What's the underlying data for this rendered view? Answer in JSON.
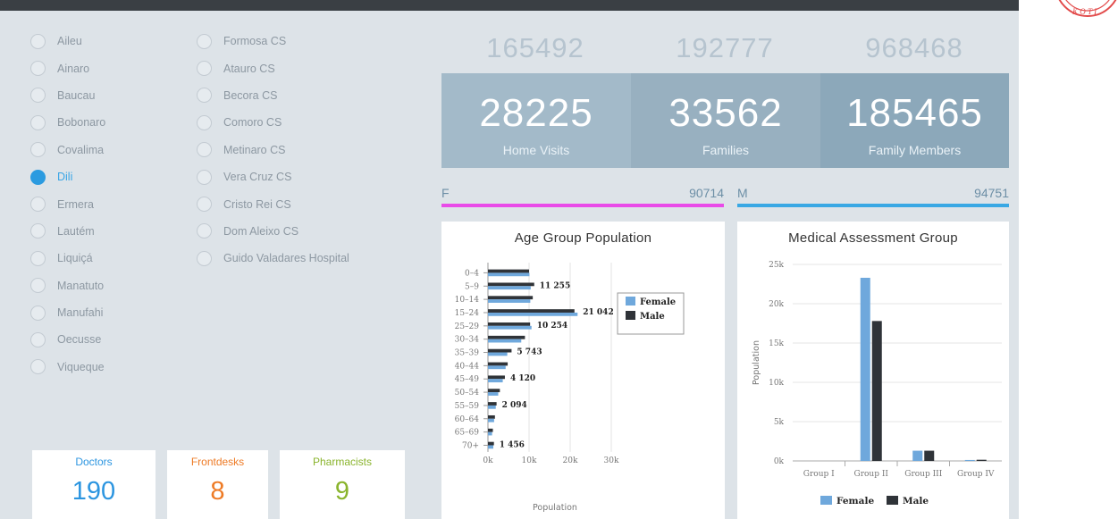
{
  "districts": [
    {
      "label": "Aileu",
      "selected": false
    },
    {
      "label": "Ainaro",
      "selected": false
    },
    {
      "label": "Baucau",
      "selected": false
    },
    {
      "label": "Bobonaro",
      "selected": false
    },
    {
      "label": "Covalima",
      "selected": false
    },
    {
      "label": "Dili",
      "selected": true
    },
    {
      "label": "Ermera",
      "selected": false
    },
    {
      "label": "Lautém",
      "selected": false
    },
    {
      "label": "Liquiçá",
      "selected": false
    },
    {
      "label": "Manatuto",
      "selected": false
    },
    {
      "label": "Manufahi",
      "selected": false
    },
    {
      "label": "Oecusse",
      "selected": false
    },
    {
      "label": "Viqueque",
      "selected": false
    }
  ],
  "facilities": [
    {
      "label": "Formosa CS"
    },
    {
      "label": "Atauro CS"
    },
    {
      "label": "Becora CS"
    },
    {
      "label": "Comoro CS"
    },
    {
      "label": "Metinaro CS"
    },
    {
      "label": "Vera Cruz CS"
    },
    {
      "label": "Cristo Rei CS"
    },
    {
      "label": "Dom Aleixo CS"
    },
    {
      "label": "Guido Valadares Hospital"
    }
  ],
  "summary_top": [
    "165492",
    "192777",
    "968468"
  ],
  "kpis": [
    {
      "value": "28225",
      "label": "Home Visits",
      "color": "#a3bac9"
    },
    {
      "value": "33562",
      "label": "Families",
      "color": "#98b0c0"
    },
    {
      "value": "185465",
      "label": "Family Members",
      "color": "#8ca8ba"
    }
  ],
  "gender": {
    "female": {
      "letter": "F",
      "value": "90714",
      "color": "#e94be8"
    },
    "male": {
      "letter": "M",
      "value": "94751",
      "color": "#39a8e4"
    }
  },
  "staff": [
    {
      "label": "Doctors",
      "value": "190",
      "color": "#2c95e0"
    },
    {
      "label": "Frontdesks",
      "value": "8",
      "color": "#ee7b26"
    },
    {
      "label": "Pharmacists",
      "value": "9",
      "color": "#8ab42d"
    }
  ],
  "chart_data": [
    {
      "type": "bar",
      "orientation": "horizontal",
      "title": "Age Group Population",
      "xlabel": "Population",
      "ylabel": "",
      "xlim": [
        0,
        30000
      ],
      "x_ticks": [
        "0k",
        "10k",
        "20k",
        "30k"
      ],
      "categories": [
        "0–4",
        "5–9",
        "10–14",
        "15–24",
        "25–29",
        "30–34",
        "35–39",
        "40–44",
        "45–49",
        "50–54",
        "55–59",
        "60–64",
        "65–69",
        "70+"
      ],
      "series": [
        {
          "name": "Female",
          "color": "#6fa8dc",
          "values": [
            10100,
            10400,
            10300,
            21800,
            10600,
            8100,
            4700,
            4300,
            3600,
            2500,
            1900,
            1500,
            1000,
            1300
          ]
        },
        {
          "name": "Male",
          "color": "#2f3338",
          "values": [
            10000,
            11255,
            10900,
            21042,
            10254,
            9000,
            5743,
            4800,
            4120,
            2900,
            2094,
            1700,
            1200,
            1456
          ]
        }
      ],
      "data_labels": [
        {
          "category": "5–9",
          "text": "11 255"
        },
        {
          "category": "15–24",
          "text": "21 042"
        },
        {
          "category": "25–29",
          "text": "10 254"
        },
        {
          "category": "35–39",
          "text": "5 743"
        },
        {
          "category": "45–49",
          "text": "4 120"
        },
        {
          "category": "55–59",
          "text": "2 094"
        },
        {
          "category": "70+",
          "text": "1 456"
        }
      ],
      "legend": [
        "Female",
        "Male"
      ],
      "legend_position": "right"
    },
    {
      "type": "bar",
      "title": "Medical Assessment Group",
      "xlabel": "",
      "ylabel": "Population",
      "ylim": [
        0,
        25000
      ],
      "y_ticks": [
        "0k",
        "5k",
        "10k",
        "15k",
        "20k",
        "25k"
      ],
      "categories": [
        "Group I",
        "Group II",
        "Group III",
        "Group IV"
      ],
      "series": [
        {
          "name": "Female",
          "color": "#6fa8dc",
          "values": [
            0,
            23300,
            1300,
            120
          ]
        },
        {
          "name": "Male",
          "color": "#2f3338",
          "values": [
            0,
            17800,
            1300,
            150
          ]
        }
      ],
      "legend": [
        "Female",
        "Male"
      ],
      "legend_position": "bottom"
    }
  ]
}
